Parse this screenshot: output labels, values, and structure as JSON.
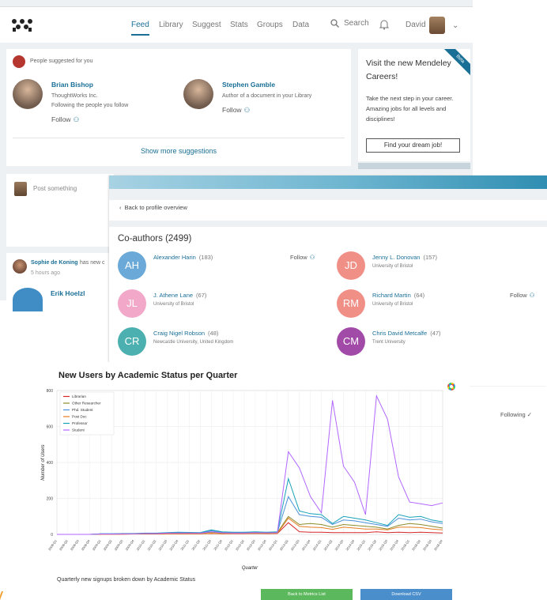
{
  "topbar": {
    "nav": [
      "Feed",
      "Library",
      "Suggest",
      "Stats",
      "Groups",
      "Data"
    ],
    "active": "Feed",
    "search_label": "Search",
    "user_name": "David"
  },
  "suggestions": {
    "header": "People suggested for you",
    "people": [
      {
        "name": "Brian Bishop",
        "line1": "ThoughtWorks Inc.",
        "line2": "Following the people you follow",
        "follow": "Follow"
      },
      {
        "name": "Stephen Gamble",
        "line1": "Author of a document in your Library",
        "line2": "",
        "follow": "Follow"
      }
    ],
    "show_more": "Show more suggestions"
  },
  "careers": {
    "badge": "Beta",
    "title": "Visit the new Mendeley Careers!",
    "body": "Take the next step in your career. Amazing jobs for all levels and disciplines!",
    "button": "Find your dream job!"
  },
  "post": {
    "placeholder": "Post something"
  },
  "activity": {
    "name": "Sophie de Koning",
    "rest": "has new c",
    "time": "5 hours ago",
    "name2": "Erik Hoelzl"
  },
  "coauthors": {
    "back": "Back to profile overview",
    "title": "Co-authors (2499)",
    "follow": "Follow",
    "following": "Following",
    "people": [
      {
        "initials": "AH",
        "name": "Alexander Harin",
        "count": "(183)",
        "aff": "",
        "color": "#6aa9d8"
      },
      {
        "initials": "JD",
        "name": "Jenny L. Donovan",
        "count": "(157)",
        "aff": "University of Bristol",
        "color": "#ef8f86"
      },
      {
        "initials": "JL",
        "name": "J. Athene Lane",
        "count": "(67)",
        "aff": "University of Bristol",
        "color": "#f2a9c9"
      },
      {
        "initials": "RM",
        "name": "Richard Martin",
        "count": "(64)",
        "aff": "University of Bristol",
        "color": "#ef8f86"
      },
      {
        "initials": "CR",
        "name": "Craig Nigel Robson",
        "count": "(48)",
        "aff": "Newcastle University, United Kingdom",
        "color": "#4db0b0"
      },
      {
        "initials": "CM",
        "name": "Chris David Metcalfe",
        "count": "(47)",
        "aff": "Trent University",
        "color": "#a24aa8"
      }
    ]
  },
  "chart": {
    "caption": "Quarterly new signups broken down by Academic Status",
    "back_button": "Back to Metrics List",
    "csv_button": "Download CSV"
  },
  "chart_data": {
    "type": "line",
    "title": "New Users by Academic Status per Quarter",
    "xlabel": "Quarter",
    "ylabel": "Number of Users",
    "ylim": [
      0,
      800
    ],
    "yticks": [
      0,
      200,
      400,
      600,
      800
    ],
    "legend_position": "top-left",
    "grid": true,
    "categories": [
      "2008-Q1",
      "2008-Q2",
      "2008-Q3",
      "2008-Q4",
      "2009-Q1",
      "2009-Q2",
      "2009-Q3",
      "2009-Q4",
      "2010-Q1",
      "2010-Q2",
      "2010-Q3",
      "2010-Q4",
      "2011-Q1",
      "2011-Q2",
      "2011-Q3",
      "2011-Q4",
      "2012-Q1",
      "2012-Q2",
      "2012-Q3",
      "2012-Q4",
      "2013-Q1",
      "2013-Q2",
      "2013-Q3",
      "2013-Q4",
      "2014-Q1",
      "2014-Q2",
      "2014-Q3",
      "2014-Q4",
      "2015-Q1",
      "2015-Q2",
      "2015-Q3",
      "2015-Q4",
      "2016-Q1",
      "2016-Q2",
      "2016-Q3",
      "2016-Q4"
    ],
    "series": [
      {
        "name": "Librarian",
        "color": "#d62728",
        "values": [
          0,
          0,
          0,
          0,
          1,
          1,
          1,
          2,
          2,
          2,
          3,
          3,
          3,
          3,
          5,
          3,
          4,
          4,
          5,
          4,
          5,
          65,
          15,
          12,
          12,
          10,
          10,
          10,
          10,
          14,
          10,
          12,
          10,
          12,
          10,
          8
        ]
      },
      {
        "name": "Other Researcher",
        "color": "#8c8c2c",
        "values": [
          0,
          0,
          0,
          0,
          2,
          2,
          3,
          3,
          4,
          4,
          6,
          7,
          7,
          6,
          12,
          8,
          8,
          9,
          10,
          9,
          10,
          100,
          55,
          60,
          55,
          40,
          55,
          50,
          45,
          40,
          30,
          50,
          60,
          55,
          45,
          35
        ]
      },
      {
        "name": "Phd. Student",
        "color": "#4a90d9",
        "values": [
          0,
          0,
          0,
          0,
          3,
          3,
          4,
          4,
          6,
          6,
          8,
          9,
          9,
          8,
          20,
          12,
          10,
          10,
          12,
          10,
          12,
          210,
          110,
          100,
          95,
          55,
          80,
          75,
          65,
          55,
          45,
          90,
          80,
          85,
          70,
          60
        ]
      },
      {
        "name": "Post Doc",
        "color": "#e67e22",
        "values": [
          0,
          0,
          0,
          0,
          1,
          1,
          2,
          2,
          3,
          3,
          4,
          4,
          4,
          4,
          6,
          4,
          5,
          5,
          6,
          5,
          6,
          90,
          45,
          40,
          38,
          28,
          40,
          35,
          30,
          30,
          25,
          40,
          40,
          38,
          30,
          25
        ]
      },
      {
        "name": "Professor",
        "color": "#17a2b8",
        "values": [
          0,
          0,
          0,
          0,
          3,
          3,
          5,
          5,
          7,
          7,
          10,
          12,
          11,
          10,
          25,
          14,
          12,
          12,
          14,
          12,
          14,
          310,
          130,
          115,
          110,
          60,
          100,
          90,
          80,
          65,
          50,
          110,
          95,
          100,
          80,
          70
        ]
      },
      {
        "name": "Student",
        "color": "#b266ff",
        "values": [
          0,
          0,
          0,
          0,
          2,
          2,
          3,
          3,
          5,
          5,
          7,
          8,
          8,
          7,
          15,
          9,
          8,
          8,
          10,
          9,
          10,
          460,
          370,
          210,
          120,
          745,
          380,
          290,
          110,
          770,
          640,
          320,
          180,
          170,
          160,
          175
        ]
      }
    ]
  }
}
